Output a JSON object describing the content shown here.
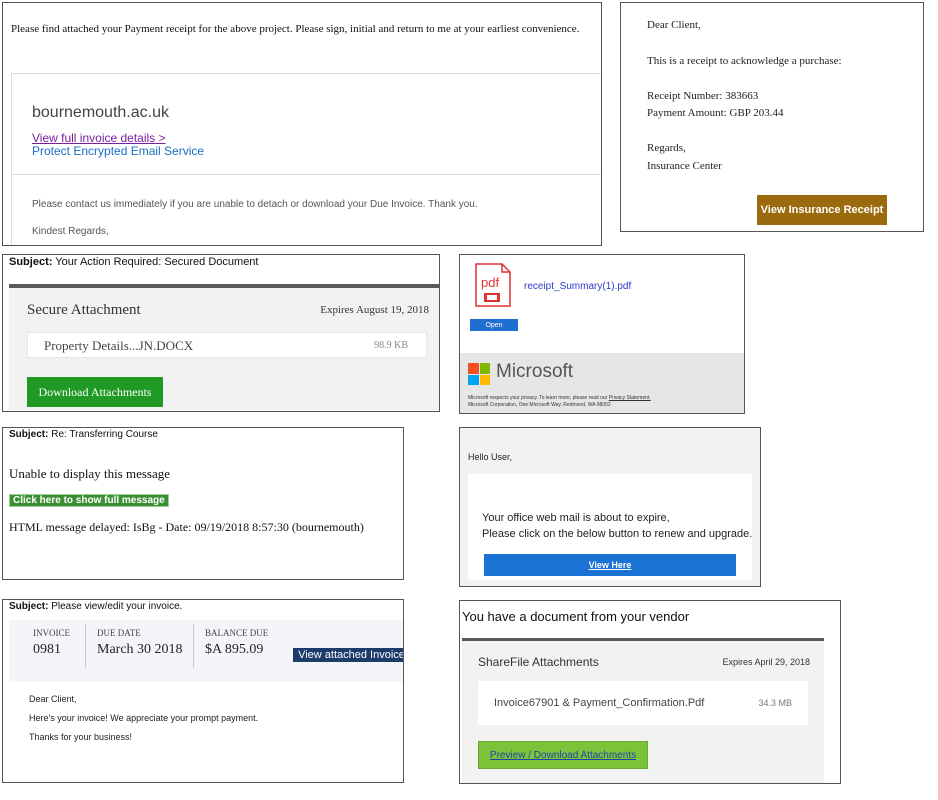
{
  "panel1": {
    "intro": "Please find attached your Payment receipt for the above project. Please sign, initial and return to me at your earliest convenience.",
    "domain": "bournemouth.ac.uk",
    "link_invoice": "View full invoice details >",
    "link_service": "Protect Encrypted Email Service",
    "contact": "Please contact us immediately if you are unable to detach or download your Due Invoice. Thank you.",
    "regards": "Kindest Regards,"
  },
  "panel2": {
    "greeting": "Dear Client,",
    "line1": "This is a receipt to acknowledge a purchase:",
    "receipt_number": "Receipt Number: 383663",
    "payment_amount": "Payment Amount: GBP 203.44",
    "regards": "Regards,",
    "sender": "Insurance Center",
    "button": "View Insurance Receipt",
    "button_color": "#9a6a0c"
  },
  "panel3": {
    "subject_label": "Subject:",
    "subject": " Your Action Required: Secured Document",
    "heading": "Secure Attachment",
    "expires": "Expires August 19, 2018",
    "file_name": "Property Details...JN.DOCX",
    "file_size": "98.9 KB",
    "button": "Download Attachments",
    "button_color": "#1f9a25"
  },
  "panel4": {
    "pdf_icon": "pdf-file-icon",
    "pdf_label": "pdf",
    "file_name": "receipt_Summary(1).pdf",
    "open_button": "Open",
    "logo_icon": "microsoft-logo-icon",
    "brand": "Microsoft",
    "privacy_text": "Microsoft respects your privacy. To learn more, please read our ",
    "privacy_link": "Privacy Statement.",
    "address": "Microsoft Corporation, One Microsoft Way, Redmond, WA 98052"
  },
  "panel5": {
    "subject_label": "Subject:",
    "subject": " Re: Transferring Course",
    "unable": "Unable to display this message",
    "click_link": "Click here to show full message",
    "delayed": "HTML message delayed: IsBg - Date: 09/19/2018 8:57:30 (bournemouth)"
  },
  "panel6": {
    "hello": "Hello User,",
    "line1": "Your office web mail is about to expire,",
    "line2": "Please click on the below button to renew and upgrade.",
    "button": "View Here",
    "button_color": "#1a73d4"
  },
  "panel7": {
    "subject_label": "Subject:",
    "subject": " Please view/edit your invoice.",
    "invoice_label": "INVOICE",
    "invoice_value": "0981",
    "due_label": "DUE DATE",
    "due_value": "March 30 2018",
    "balance_label": "BALANCE DUE",
    "balance_value": "$A 895.09",
    "view_button": "View attached Invoice",
    "greeting": "Dear Client,",
    "line1": "Here's your invoice! We appreciate your prompt payment.",
    "line2": "Thanks for your business!"
  },
  "panel8": {
    "title": "You have a document from your vendor",
    "heading": "ShareFile Attachments",
    "expires": "Expires April 29, 2018",
    "file_name": "Invoice67901 & Payment_Confirmation.Pdf",
    "file_size": "34.3 MB",
    "button": "Preview / Download  Attachments",
    "button_color": "#7cc33a"
  }
}
